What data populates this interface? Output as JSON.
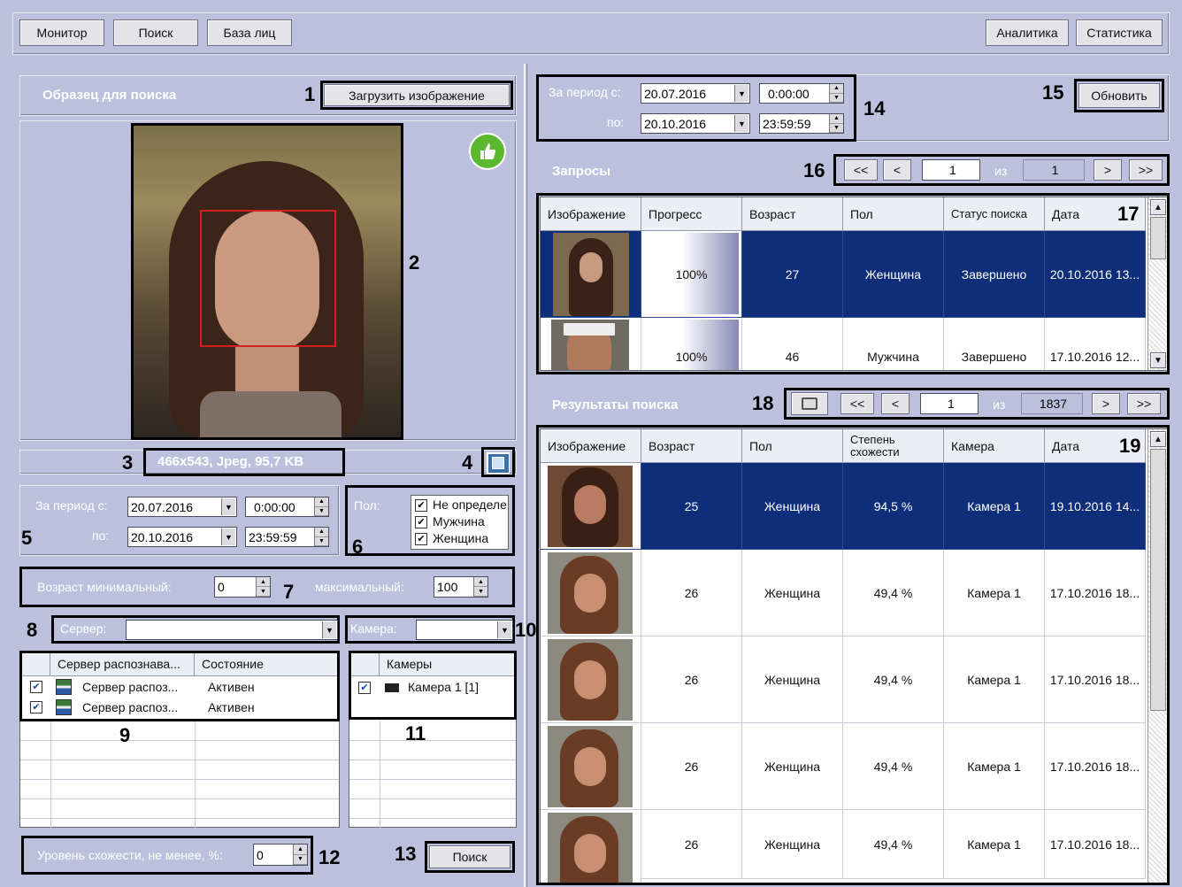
{
  "toolbar": {
    "monitor": "Монитор",
    "search": "Поиск",
    "face_base": "База лиц",
    "analytics": "Аналитика",
    "statistics": "Статистика"
  },
  "sample": {
    "title": "Образец для поиска",
    "load_button": "Загрузить изображение",
    "image_info": "466x543, Jpeg, 95,7 KB"
  },
  "period": {
    "from_label": "За период с:",
    "to_label": "по:",
    "from_date": "20.07.2016",
    "from_time": "0:00:00",
    "to_date": "20.10.2016",
    "to_time": "23:59:59"
  },
  "gender_filter": {
    "label": "Пол:",
    "options": [
      {
        "label": "Не определе",
        "checked": true
      },
      {
        "label": "Мужчина",
        "checked": true
      },
      {
        "label": "Женщина",
        "checked": true
      }
    ]
  },
  "age": {
    "min_label": "Возраст минимальный:",
    "min_value": "0",
    "max_label": "максимальный:",
    "max_value": "100"
  },
  "server": {
    "label": "Сервер:",
    "value": "",
    "columns": [
      "Сервер распознава...",
      "Состояние"
    ],
    "rows": [
      {
        "name": "Сервер распоз...",
        "state": "Активен",
        "checked": true
      },
      {
        "name": "Сервер распоз...",
        "state": "Активен",
        "checked": true
      }
    ]
  },
  "camera": {
    "label": "Камера:",
    "value": "",
    "column": "Камеры",
    "rows": [
      {
        "name": "Камера 1 [1]",
        "checked": true
      }
    ]
  },
  "similarity": {
    "label": "Уровень схожести, не менее, %:",
    "value": "0",
    "search_button": "Поиск"
  },
  "right_period": {
    "from_label": "За период с:",
    "to_label": "по:",
    "from_date": "20.07.2016",
    "from_time": "0:00:00",
    "to_date": "20.10.2016",
    "to_time": "23:59:59",
    "refresh_button": "Обновить"
  },
  "requests": {
    "title": "Запросы",
    "pager": {
      "first": "<<",
      "prev": "<",
      "page": "1",
      "of": "из",
      "total": "1",
      "next": ">",
      "last": ">>"
    },
    "columns": [
      "Изображение",
      "Прогресс",
      "Возраст",
      "Пол",
      "Статус поиска",
      "Дата"
    ],
    "rows": [
      {
        "progress": "100%",
        "progress_value": 1.0,
        "age": "27",
        "gender": "Женщина",
        "status": "Завершено",
        "date": "20.10.2016 13...",
        "selected": true
      },
      {
        "progress": "100%",
        "progress_value": 1.0,
        "age": "46",
        "gender": "Мужчина",
        "status": "Завершено",
        "date": "17.10.2016 12...",
        "selected": false
      }
    ]
  },
  "results": {
    "title": "Результаты поиска",
    "pager": {
      "first": "<<",
      "prev": "<",
      "page": "1",
      "of": "из",
      "total": "1837",
      "next": ">",
      "last": ">>"
    },
    "columns": [
      "Изображение",
      "Возраст",
      "Пол",
      "Степень схожести",
      "Камера",
      "Дата"
    ],
    "rows": [
      {
        "age": "25",
        "gender": "Женщина",
        "similarity": "94,5 %",
        "camera": "Камера 1",
        "date": "19.10.2016 14...",
        "selected": true
      },
      {
        "age": "26",
        "gender": "Женщина",
        "similarity": "49,4 %",
        "camera": "Камера 1",
        "date": "17.10.2016 18...",
        "selected": false
      },
      {
        "age": "26",
        "gender": "Женщина",
        "similarity": "49,4 %",
        "camera": "Камера 1",
        "date": "17.10.2016 18...",
        "selected": false
      },
      {
        "age": "26",
        "gender": "Женщина",
        "similarity": "49,4 %",
        "camera": "Камера 1",
        "date": "17.10.2016 18...",
        "selected": false
      },
      {
        "age": "26",
        "gender": "Женщина",
        "similarity": "49,4 %",
        "camera": "Камера 1",
        "date": "17.10.2016 18...",
        "selected": false
      }
    ]
  },
  "callouts": [
    "1",
    "2",
    "3",
    "4",
    "5",
    "6",
    "7",
    "8",
    "9",
    "10",
    "11",
    "12",
    "13",
    "14",
    "15",
    "16",
    "17",
    "18",
    "19"
  ],
  "icons": [
    "thumbs-up-icon",
    "save-icon",
    "printer-icon",
    "server-icon",
    "camera-icon",
    "scroll-up-icon",
    "scroll-down-icon"
  ]
}
